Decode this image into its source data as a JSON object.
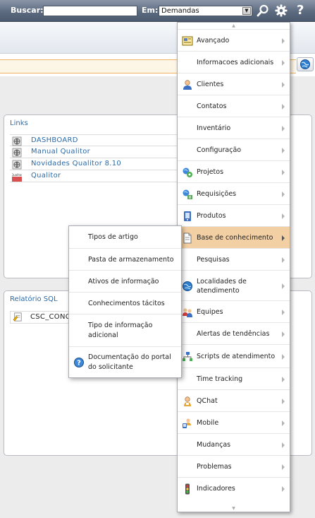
{
  "topbar": {
    "search_label": "Buscar:",
    "search_value": "",
    "scope_label": "Em:",
    "scope_value": "Demandas",
    "search_icon": "magnifier-icon",
    "settings_icon": "gear-icon",
    "help_icon": "question-mark-icon",
    "help_glyph": "?"
  },
  "links_box": {
    "title": "Links",
    "items": [
      {
        "label": "DASHBOARD",
        "icon": "globe-page-icon"
      },
      {
        "label": "Manual Qualitor",
        "icon": "globe-page-icon"
      },
      {
        "label": "Novidades Qualitor 8.10",
        "icon": "globe-page-icon"
      },
      {
        "label": "Qualitor",
        "icon": "qualitor-logo-icon"
      }
    ]
  },
  "sql_box": {
    "title": "Relatório SQL",
    "items": [
      {
        "label": "CSC_CONC",
        "icon": "report-icon"
      }
    ]
  },
  "menu": {
    "items": [
      {
        "label": "Avançado",
        "icon": "advanced-icon"
      },
      {
        "label": "Informacoes adicionais",
        "icon": ""
      },
      {
        "label": "Clientes",
        "icon": "client-icon"
      },
      {
        "label": "Contatos",
        "icon": ""
      },
      {
        "label": "Inventário",
        "icon": ""
      },
      {
        "label": "Configuração",
        "icon": ""
      },
      {
        "label": "Projetos",
        "icon": "projects-icon"
      },
      {
        "label": "Requisições",
        "icon": "requests-icon"
      },
      {
        "label": "Produtos",
        "icon": "products-icon"
      },
      {
        "label": "Base de conhecimento",
        "icon": "knowledge-base-icon"
      },
      {
        "label": "Pesquisas",
        "icon": ""
      },
      {
        "label": "Localidades de atendimento",
        "icon": "globe-icon"
      },
      {
        "label": "Equipes",
        "icon": "teams-icon"
      },
      {
        "label": "Alertas de tendências",
        "icon": ""
      },
      {
        "label": "Scripts de atendimento",
        "icon": "scripts-icon"
      },
      {
        "label": "Time tracking",
        "icon": ""
      },
      {
        "label": "QChat",
        "icon": "chat-icon"
      },
      {
        "label": "Mobile",
        "icon": "mobile-icon"
      },
      {
        "label": "Mudanças",
        "icon": ""
      },
      {
        "label": "Problemas",
        "icon": ""
      },
      {
        "label": "Indicadores",
        "icon": "traffic-light-icon"
      }
    ],
    "active_index": 9
  },
  "submenu": {
    "items": [
      {
        "label": "Tipos de artigo",
        "icon": ""
      },
      {
        "label": "Pasta de armazenamento",
        "icon": ""
      },
      {
        "label": "Ativos de informação",
        "icon": ""
      },
      {
        "label": "Conhecimentos tácitos",
        "icon": ""
      },
      {
        "label": "Tipo de informação adicional",
        "icon": ""
      },
      {
        "label": "Documentação do portal do solicitante",
        "icon": "help-icon"
      }
    ]
  },
  "colors": {
    "topbar": "#5d6b80",
    "link": "#2b6aa8",
    "active_item": "#f3cfa4",
    "orange_strip_border": "#f1b464"
  }
}
